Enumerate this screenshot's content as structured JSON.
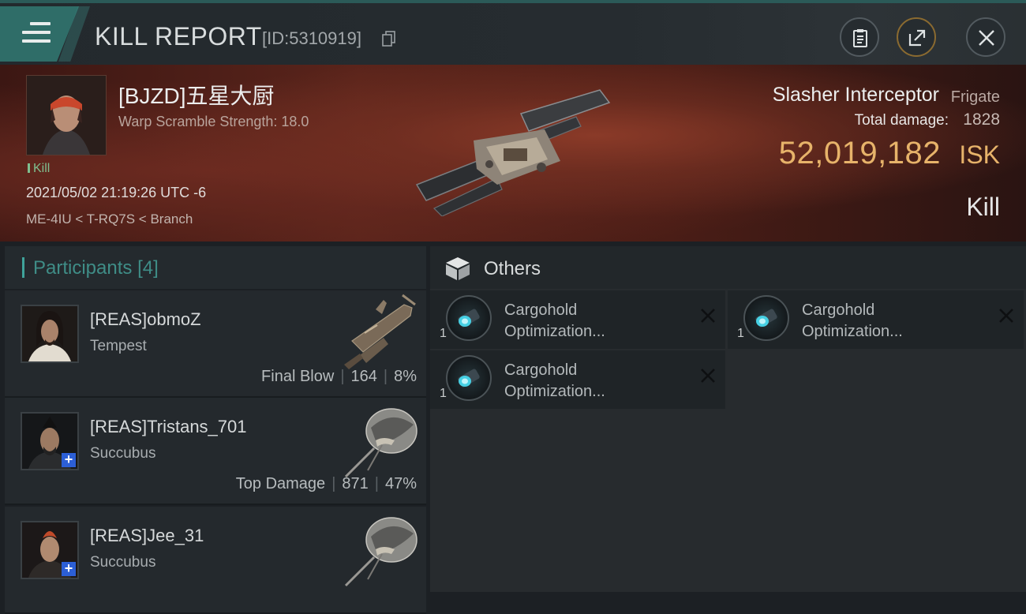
{
  "header": {
    "title": "KILL REPORT",
    "id_text": "[ID:5310919]"
  },
  "victim": {
    "name": "[BJZD]五星大厨",
    "subtitle": "Warp Scramble Strength: 18.0",
    "tag": "Kill",
    "time": "2021/05/02 21:19:26 UTC -6",
    "location": "ME-4IU < T-RQ7S < Branch",
    "ship_name": "Slasher Interceptor",
    "ship_class": "Frigate",
    "damage_label": "Total damage:",
    "damage_value": "1828",
    "isk_value": "52,019,182",
    "isk_unit": "ISK",
    "result": "Kill"
  },
  "participants": {
    "label": "Participants",
    "count": "[4]",
    "items": [
      {
        "name": "[REAS]obmoZ",
        "ship": "Tempest",
        "role": "Final Blow",
        "damage": "164",
        "percent": "8%"
      },
      {
        "name": "[REAS]Tristans_701",
        "ship": "Succubus",
        "role": "Top Damage",
        "damage": "871",
        "percent": "47%"
      },
      {
        "name": "[REAS]Jee_31",
        "ship": "Succubus",
        "role": "",
        "damage": "",
        "percent": ""
      }
    ]
  },
  "others": {
    "label": "Others",
    "items": [
      {
        "name": "Cargohold Optimization...",
        "line1": "Cargohold",
        "line2": "Optimization...",
        "qty": "1"
      },
      {
        "name": "Cargohold Optimization...",
        "line1": "Cargohold",
        "line2": "Optimization...",
        "qty": "1"
      },
      {
        "name": "Cargohold Optimization...",
        "line1": "Cargohold",
        "line2": "Optimization...",
        "qty": "1"
      }
    ]
  },
  "colors": {
    "accent": "#3f8d87",
    "isk": "#e7b36a",
    "banner": "#5a241b"
  }
}
